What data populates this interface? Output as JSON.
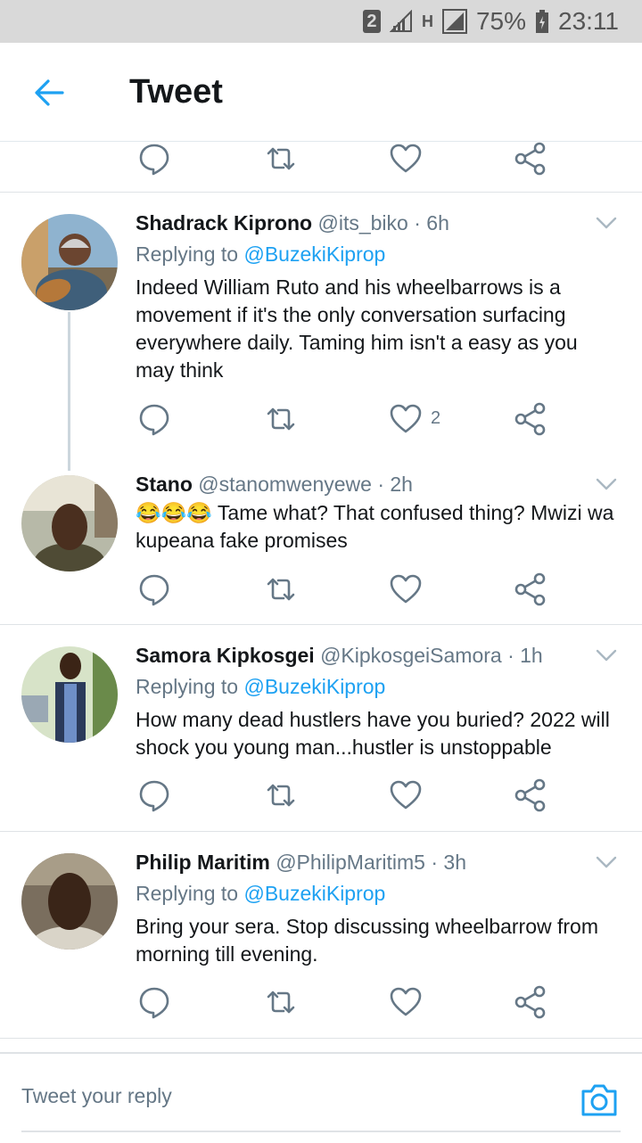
{
  "status": {
    "sim": "2",
    "net": "H",
    "battery": "75%",
    "time": "23:11"
  },
  "appbar": {
    "title": "Tweet"
  },
  "tweets": [
    {
      "name": "Shadrack Kiprono",
      "handle": "@its_biko",
      "time": "· 6h",
      "reply_label": "Replying to",
      "reply_to": "@BuzekiKiprop",
      "text": "Indeed William Ruto and his wheelbarrows is a movement if it's the only conversation surfacing everywhere daily. Taming him isn't a easy as you may think",
      "likes": "2"
    },
    {
      "name": "Stano",
      "handle": "@stanomwenyewe",
      "time": "· 2h",
      "emoji": "😂😂😂",
      "text": "Tame what? That confused thing? Mwizi wa kupeana fake promises"
    },
    {
      "name": "Samora Kipkosgei",
      "handle": "@KipkosgeiSamora",
      "time": "· 1h",
      "reply_label": "Replying to",
      "reply_to": "@BuzekiKiprop",
      "text": "How many  dead hustlers have you buried? 2022 will shock  you young man...hustler is unstoppable"
    },
    {
      "name": "Philip Maritim",
      "handle": "@PhilipMaritim5",
      "time": "· 3h",
      "reply_label": "Replying to",
      "reply_to": "@BuzekiKiprop",
      "text": "Bring your sera. Stop discussing wheelbarrow from morning till evening."
    }
  ],
  "composer": {
    "placeholder": "Tweet your reply"
  },
  "colors": {
    "accent": "#1da1f2",
    "muted": "#657786",
    "separator": "#dfe3e6"
  },
  "icons": [
    "arrow-left-icon",
    "reply-icon",
    "retweet-icon",
    "like-icon",
    "share-icon",
    "chevron-down-icon",
    "camera-icon"
  ]
}
